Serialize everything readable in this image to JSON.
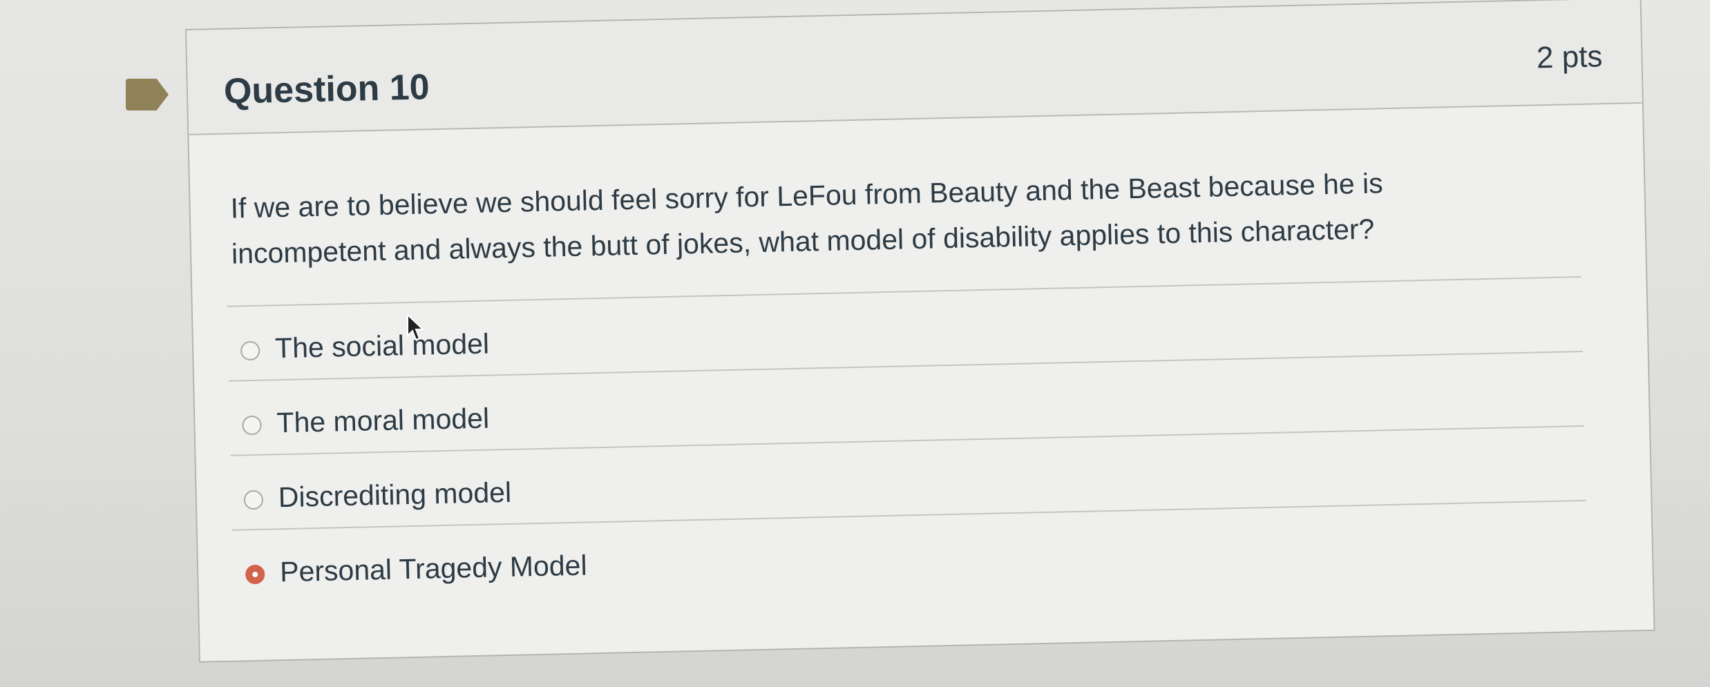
{
  "question": {
    "title": "Question 10",
    "points": "2 pts",
    "text": "If we are to believe we should feel sorry for LeFou from Beauty and the Beast because he is incompetent and always the butt of jokes, what  model of disability applies to this character?"
  },
  "answers": [
    {
      "label": "The social model",
      "selected": false
    },
    {
      "label": "The moral model",
      "selected": false
    },
    {
      "label": "Discrediting model",
      "selected": false
    },
    {
      "label": "Personal Tragedy Model",
      "selected": true
    }
  ],
  "colors": {
    "selected_radio": "#d0634a",
    "flag": "#8f8258",
    "text": "#2d3b45"
  },
  "icons": {
    "flag": "question-flag-icon",
    "cursor": "mouse-pointer-icon"
  }
}
